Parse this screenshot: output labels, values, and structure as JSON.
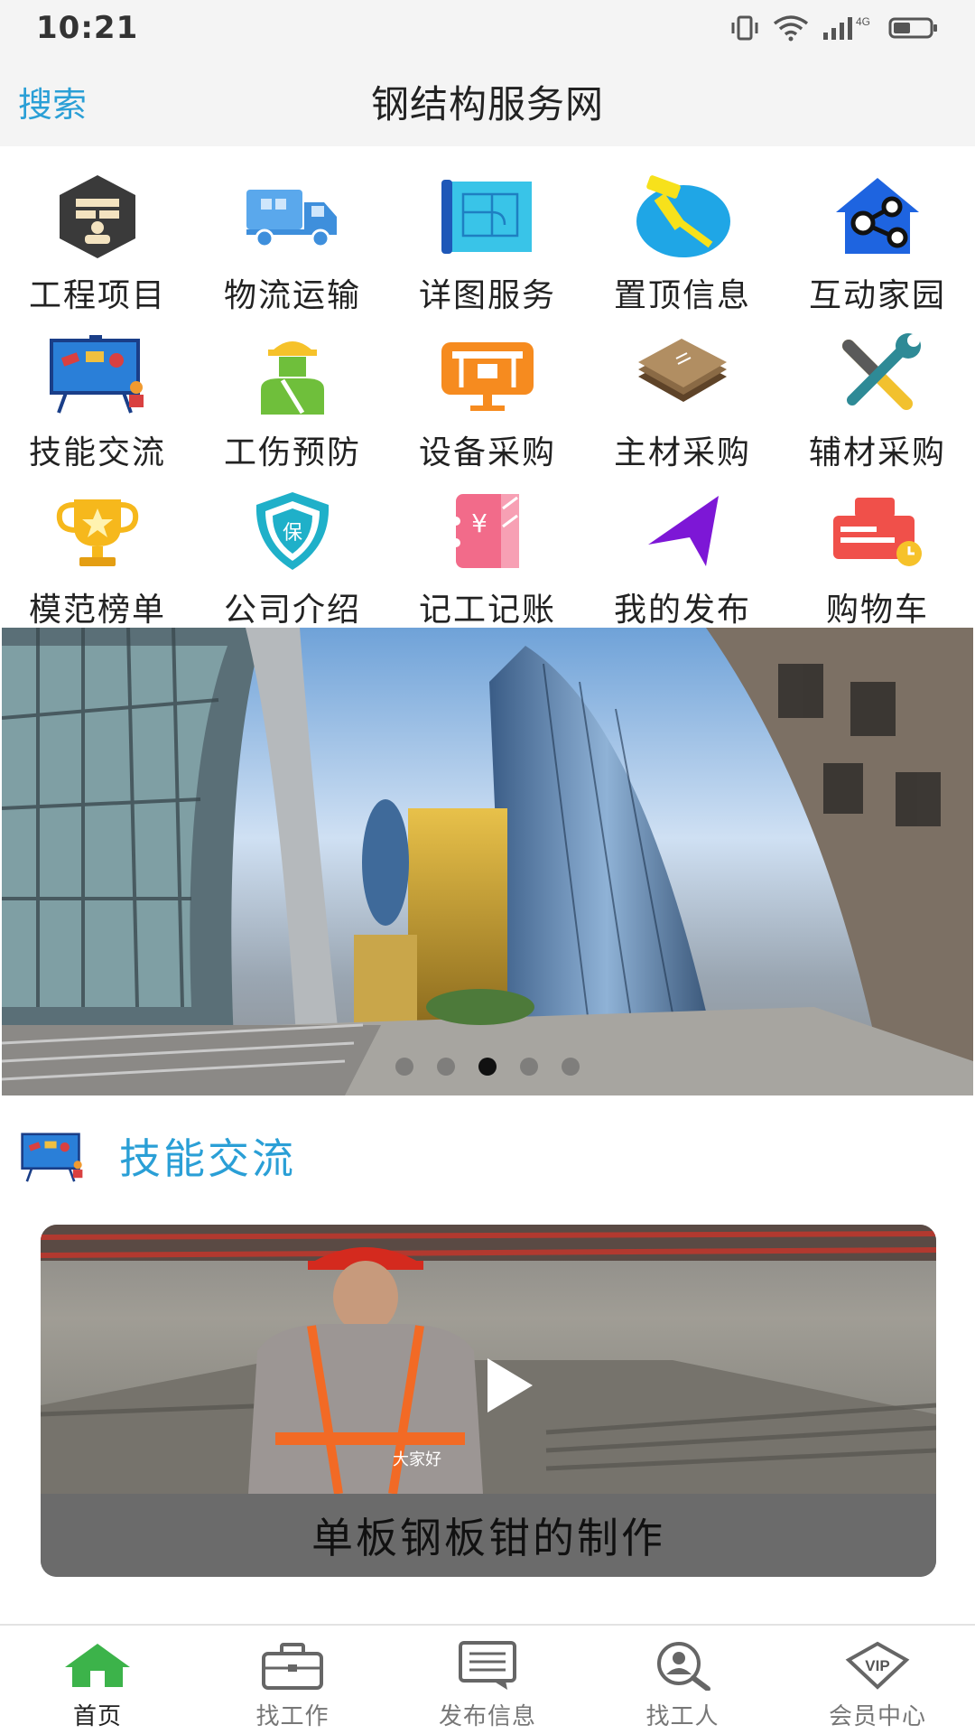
{
  "status_bar": {
    "time": "10:21",
    "network": "4G"
  },
  "header": {
    "search_label": "搜索",
    "title": "钢结构服务网"
  },
  "grid": [
    {
      "label": "工程项目",
      "icon": "project-icon"
    },
    {
      "label": "物流运输",
      "icon": "truck-icon"
    },
    {
      "label": "详图服务",
      "icon": "blueprint-icon"
    },
    {
      "label": "置顶信息",
      "icon": "pin-icon"
    },
    {
      "label": "互动家园",
      "icon": "share-home-icon"
    },
    {
      "label": "技能交流",
      "icon": "training-board-icon"
    },
    {
      "label": "工伤预防",
      "icon": "worker-icon"
    },
    {
      "label": "设备采购",
      "icon": "equipment-icon"
    },
    {
      "label": "主材采购",
      "icon": "steel-plates-icon"
    },
    {
      "label": "辅材采购",
      "icon": "tools-icon"
    },
    {
      "label": "模范榜单",
      "icon": "trophy-icon"
    },
    {
      "label": "公司介绍",
      "icon": "shield-icon"
    },
    {
      "label": "记工记账",
      "icon": "ledger-icon"
    },
    {
      "label": "我的发布",
      "icon": "send-arrow-icon"
    },
    {
      "label": "购物车",
      "icon": "cart-icon"
    }
  ],
  "banner": {
    "slide_count": 5,
    "active_index": 2
  },
  "section": {
    "title": "技能交流"
  },
  "video": {
    "caption": "单板钢板钳的制作",
    "overlay_text": "大家好"
  },
  "bottom_nav": [
    {
      "label": "首页",
      "icon": "home-icon",
      "active": true
    },
    {
      "label": "找工作",
      "icon": "briefcase-icon",
      "active": false
    },
    {
      "label": "发布信息",
      "icon": "message-icon",
      "active": false
    },
    {
      "label": "找工人",
      "icon": "find-worker-icon",
      "active": false
    },
    {
      "label": "会员中心",
      "icon": "vip-icon",
      "active": false
    }
  ],
  "colors": {
    "accent": "#2a9fd6",
    "active_nav": "#3cb34a"
  }
}
